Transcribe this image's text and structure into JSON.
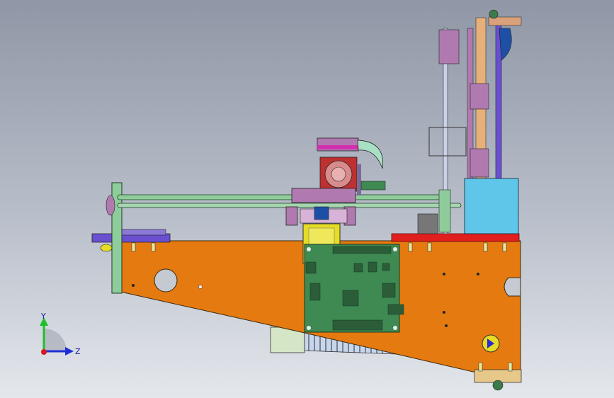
{
  "viewport": {
    "background_top": "#8f97a6",
    "background_bottom": "#e4e7ec"
  },
  "triad": {
    "y_label": "Y",
    "z_label": "Z",
    "y_color": "#1fbf2a",
    "z_color": "#1f2fd6",
    "x_color": "#d41a1a"
  },
  "parts": {
    "base_plate_color": "#e57a10",
    "controller_board_color": "#3e8a52",
    "rail_color": "#8fcc9b",
    "stepper_motor_color": "#e6dc24",
    "carriage_color": "#b07ab0",
    "red_bar_color": "#e21f1f",
    "blue_block_color": "#5fc6ea",
    "purple_bracket_color": "#6a4fd0"
  }
}
